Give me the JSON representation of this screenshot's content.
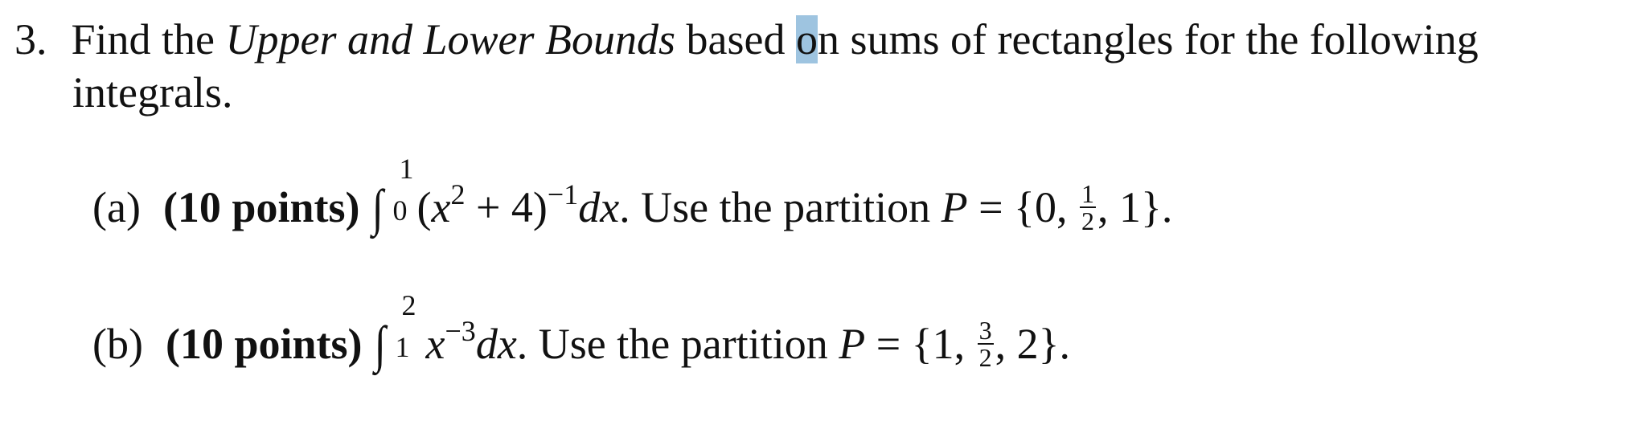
{
  "problem": {
    "number": "3.",
    "intro": {
      "part1": "Find the ",
      "emphasis": "Upper and Lower Bounds",
      "part2": " based ",
      "highlighted": "o",
      "part3": "n sums of rectangles for the following",
      "line2": "integrals."
    },
    "highlight_color": "#9ec4e0",
    "parts": [
      {
        "label": "(a)",
        "points": "(10 points)",
        "integral": {
          "sign": "∫",
          "upper": "1",
          "lower": "0",
          "integrand_open": "(",
          "var": "x",
          "power": "2",
          "plus": " + 4)",
          "outer_power": "−1",
          "differential": "dx"
        },
        "instruction": ". Use the partition ",
        "partition_var": "P",
        "equals": " = {0, ",
        "fraction": {
          "num": "1",
          "den": "2"
        },
        "tail": ", 1}."
      },
      {
        "label": "(b)",
        "points": "(10 points)",
        "integral": {
          "sign": "∫",
          "upper": "2",
          "lower": "1",
          "var": "x",
          "power": "−3",
          "differential": "dx"
        },
        "instruction": ". Use the partition ",
        "partition_var": "P",
        "equals": " = {1, ",
        "fraction": {
          "num": "3",
          "den": "2"
        },
        "tail": ", 2}."
      }
    ]
  }
}
